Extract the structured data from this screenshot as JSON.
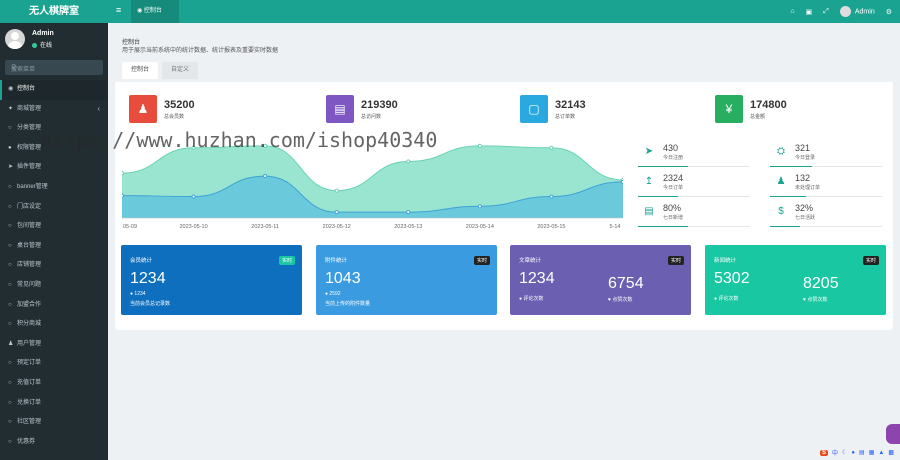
{
  "app": {
    "logo": "无人棋牌室"
  },
  "user": {
    "name": "Admin",
    "status": "在线"
  },
  "search": {
    "placeholder": "搜索菜单"
  },
  "sidebar": {
    "items": [
      {
        "label": "控制台",
        "icon": "dashboard-icon",
        "active": true
      },
      {
        "label": "商城管理",
        "icon": "share-icon",
        "arrow": "‹"
      },
      {
        "label": "分类管理",
        "icon": "circle-icon"
      },
      {
        "label": "权限管理",
        "icon": "group-icon"
      },
      {
        "label": "插件管理",
        "icon": "rocket-icon"
      },
      {
        "label": "banner管理",
        "icon": "circle-icon"
      },
      {
        "label": "门店设定",
        "icon": "circle-icon"
      },
      {
        "label": "包间管理",
        "icon": "circle-icon"
      },
      {
        "label": "桌台管理",
        "icon": "circle-icon"
      },
      {
        "label": "店铺管理",
        "icon": "circle-icon"
      },
      {
        "label": "常见问题",
        "icon": "circle-icon"
      },
      {
        "label": "加盟合作",
        "icon": "circle-icon"
      },
      {
        "label": "积分商城",
        "icon": "circle-icon"
      },
      {
        "label": "用户管理",
        "icon": "user-icon"
      },
      {
        "label": "预定订单",
        "icon": "circle-icon"
      },
      {
        "label": "充值订单",
        "icon": "circle-icon"
      },
      {
        "label": "兑换订单",
        "icon": "circle-icon"
      },
      {
        "label": "社区管理",
        "icon": "circle-icon"
      },
      {
        "label": "优惠券",
        "icon": "circle-icon"
      }
    ]
  },
  "topbar": {
    "tab": "控制台",
    "admin": "Admin"
  },
  "page": {
    "title": "控制台",
    "desc": "用于展示当前系统中的统计数据、统计报表及重要实时数据",
    "tabs": [
      "控制台",
      "自定义"
    ]
  },
  "stats": [
    {
      "value": "35200",
      "label": "总会员数",
      "color": "#e74c3c",
      "icon": "users-icon"
    },
    {
      "value": "219390",
      "label": "总访问数",
      "color": "#7e57c2",
      "icon": "book-icon"
    },
    {
      "value": "32143",
      "label": "总订单数",
      "color": "#29a9e0",
      "icon": "shopping-bag-icon"
    },
    {
      "value": "174800",
      "label": "总金额",
      "color": "#27ae60",
      "icon": "yen-icon"
    }
  ],
  "chart_data": {
    "type": "area",
    "x": [
      "05-09",
      "2023-05-10",
      "2023-05-11",
      "2023-05-12",
      "2023-05-13",
      "2023-05-14",
      "2023-05-15",
      "5-14"
    ],
    "series": [
      {
        "values": [
          230,
          360,
          370,
          140,
          290,
          370,
          360,
          195
        ],
        "color": "#88e0c7"
      },
      {
        "values": [
          115,
          110,
          215,
          30,
          30,
          60,
          110,
          185
        ],
        "color": "#5bbfe0"
      }
    ],
    "ylim": [
      0,
      400
    ],
    "grid": false
  },
  "minis": [
    {
      "value": "430",
      "label": "今日注册",
      "icon": "rocket-icon"
    },
    {
      "value": "321",
      "label": "今日登录",
      "icon": "cart-icon"
    },
    {
      "value": "2324",
      "label": "今日订单",
      "icon": "area-chart-icon"
    },
    {
      "value": "132",
      "label": "未处理订单",
      "icon": "users-icon"
    },
    {
      "value": "80%",
      "label": "七日新增",
      "icon": "list-icon"
    },
    {
      "value": "32%",
      "label": "七日活跃",
      "icon": "dollar-icon"
    }
  ],
  "cards": [
    {
      "title": "会员统计",
      "badge": "实时",
      "value": "1234",
      "sub": "1234",
      "desc": "当前会员总记录数",
      "bg": "#0e6fbe"
    },
    {
      "title": "附件统计",
      "badge": "实时",
      "value": "1043",
      "sub": "2592",
      "desc": "当前上传的附件数量",
      "bg": "#3a9be0"
    },
    {
      "title": "文章统计",
      "badge": "实时",
      "value": "1234",
      "value2": "6754",
      "desc": "评论次数",
      "desc2": "点赞次数",
      "bg": "#6a5fb0"
    },
    {
      "title": "新闻统计",
      "badge": "实时",
      "value": "5302",
      "value2": "8205",
      "desc": "评论次数",
      "desc2": "点赞次数",
      "bg": "#19c7a2"
    }
  ],
  "watermark": "https://www.huzhan.com/ishop40340",
  "tools": {
    "s": "S",
    "zh": "中"
  }
}
